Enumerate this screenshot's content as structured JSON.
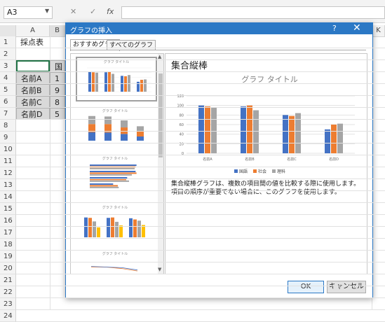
{
  "excel": {
    "namebox": "A3",
    "fx_label": "fx",
    "cancel_glyph": "✕",
    "enter_glyph": "✓",
    "columns": [
      "A",
      "K"
    ],
    "partial_col_b": "B",
    "rows": [
      "1",
      "2",
      "3",
      "4",
      "5",
      "6",
      "7",
      "8",
      "9",
      "10",
      "11",
      "12",
      "13",
      "14",
      "15",
      "16",
      "17",
      "18",
      "19",
      "20",
      "21",
      "22",
      "23",
      "24"
    ],
    "cells": {
      "a1": "採点表",
      "b3": "国",
      "a4": "名前A",
      "b4": "1",
      "a5": "名前B",
      "b5": "9",
      "a6": "名前C",
      "b6": "8",
      "a7": "名前D",
      "b7": "5"
    }
  },
  "dialog": {
    "title": "グラフの挿入",
    "help": "?",
    "close": "✕",
    "tabs": [
      "おすすめグラフ",
      "すべてのグラフ"
    ],
    "thumb_title": "グラフ タイトル",
    "chart_type_title": "集合縦棒",
    "description": "集合縦棒グラフは、複数の項目間の値を比較する際に使用します。項目の順序が重要でない場合に、このグラフを使用します。",
    "ok": "OK",
    "cancel": "キャンセル",
    "scroll_up": "▲",
    "scroll_down": "▼"
  },
  "colors": {
    "series1": "#4472c4",
    "series2": "#ed7d31",
    "series3": "#a5a5a5",
    "accent": "#2b78c5"
  },
  "chart_data": {
    "type": "bar",
    "title": "グラフ タイトル",
    "categories": [
      "名前A",
      "名前B",
      "名前C",
      "名前D"
    ],
    "series": [
      {
        "name": "国語",
        "values": [
          100,
          98,
          80,
          50
        ]
      },
      {
        "name": "社会",
        "values": [
          98,
          100,
          78,
          60
        ]
      },
      {
        "name": "理科",
        "values": [
          96,
          90,
          84,
          62
        ]
      }
    ],
    "ylim": [
      0,
      120
    ],
    "yticks": [
      "0",
      "20",
      "40",
      "60",
      "80",
      "100",
      "120"
    ],
    "grid": true,
    "legend": "bottom"
  }
}
